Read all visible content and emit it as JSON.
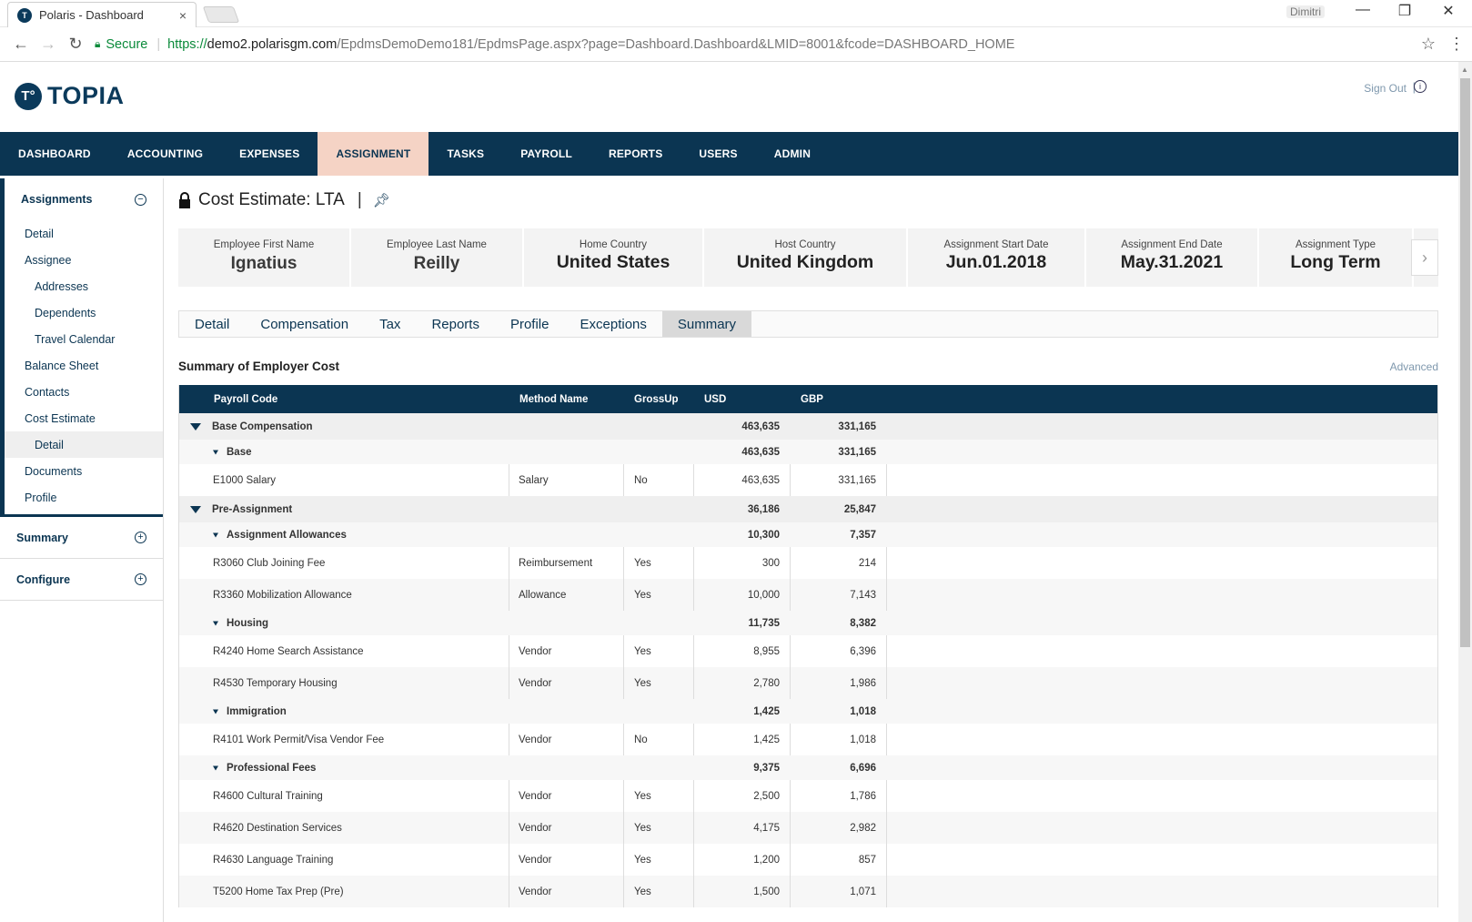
{
  "browser": {
    "tab_title": "Polaris - Dashboard",
    "tab_close": "×",
    "window_user": "Dimitri",
    "secure_label": "Secure",
    "url_proto": "https://",
    "url_host": "demo2.polarisgm.com",
    "url_path": "/EpdmsDemoDemo181/EpdmsPage.aspx?page=Dashboard.Dashboard&LMID=8001&fcode=DASHBOARD_HOME"
  },
  "app": {
    "logo_text": "TOPIA",
    "sign_out": "Sign Out"
  },
  "main_nav": [
    "DASHBOARD",
    "ACCOUNTING",
    "EXPENSES",
    "ASSIGNMENT",
    "TASKS",
    "PAYROLL",
    "REPORTS",
    "USERS",
    "ADMIN"
  ],
  "main_nav_active": "ASSIGNMENT",
  "sidebar": {
    "assignments_label": "Assignments",
    "items": [
      "Detail",
      "Assignee",
      "Addresses",
      "Dependents",
      "Travel Calendar",
      "Balance Sheet",
      "Contacts",
      "Cost Estimate",
      "Detail",
      "Documents",
      "Profile"
    ],
    "summary_label": "Summary",
    "configure_label": "Configure"
  },
  "page": {
    "title": "Cost Estimate: LTA"
  },
  "cards": [
    {
      "label": "Employee First Name",
      "value": "Ignatius"
    },
    {
      "label": "Employee Last Name",
      "value": "Reilly"
    },
    {
      "label": "Home Country",
      "value": "United States"
    },
    {
      "label": "Host Country",
      "value": "United Kingdom"
    },
    {
      "label": "Assignment Start Date",
      "value": "Jun.01.2018"
    },
    {
      "label": "Assignment End Date",
      "value": "May.31.2021"
    },
    {
      "label": "Assignment Type",
      "value": "Long Term"
    }
  ],
  "subtabs": [
    "Detail",
    "Compensation",
    "Tax",
    "Reports",
    "Profile",
    "Exceptions",
    "Summary"
  ],
  "subtab_active": "Summary",
  "summary": {
    "heading": "Summary of Employer Cost",
    "advanced": "Advanced",
    "columns": [
      "Payroll Code",
      "Method Name",
      "GrossUp",
      "USD",
      "GBP"
    ],
    "rows": [
      {
        "level": 1,
        "name": "Base Compensation",
        "usd": "463,635",
        "gbp": "331,165"
      },
      {
        "level": 2,
        "name": "Base",
        "usd": "463,635",
        "gbp": "331,165"
      },
      {
        "level": 3,
        "name": "E1000 Salary",
        "method": "Salary",
        "grossup": "No",
        "usd": "463,635",
        "gbp": "331,165"
      },
      {
        "level": 1,
        "name": "Pre-Assignment",
        "usd": "36,186",
        "gbp": "25,847"
      },
      {
        "level": 2,
        "name": "Assignment Allowances",
        "usd": "10,300",
        "gbp": "7,357"
      },
      {
        "level": 3,
        "name": "R3060 Club Joining Fee",
        "method": "Reimbursement",
        "grossup": "Yes",
        "usd": "300",
        "gbp": "214"
      },
      {
        "level": 3,
        "name": "R3360 Mobilization Allowance",
        "method": "Allowance",
        "grossup": "Yes",
        "usd": "10,000",
        "gbp": "7,143"
      },
      {
        "level": 2,
        "name": "Housing",
        "usd": "11,735",
        "gbp": "8,382"
      },
      {
        "level": 3,
        "name": "R4240 Home Search Assistance",
        "method": "Vendor",
        "grossup": "Yes",
        "usd": "8,955",
        "gbp": "6,396"
      },
      {
        "level": 3,
        "name": "R4530 Temporary Housing",
        "method": "Vendor",
        "grossup": "Yes",
        "usd": "2,780",
        "gbp": "1,986"
      },
      {
        "level": 2,
        "name": "Immigration",
        "usd": "1,425",
        "gbp": "1,018"
      },
      {
        "level": 3,
        "name": "R4101 Work Permit/Visa Vendor Fee",
        "method": "Vendor",
        "grossup": "No",
        "usd": "1,425",
        "gbp": "1,018"
      },
      {
        "level": 2,
        "name": "Professional Fees",
        "usd": "9,375",
        "gbp": "6,696"
      },
      {
        "level": 3,
        "name": "R4600 Cultural Training",
        "method": "Vendor",
        "grossup": "Yes",
        "usd": "2,500",
        "gbp": "1,786"
      },
      {
        "level": 3,
        "name": "R4620 Destination Services",
        "method": "Vendor",
        "grossup": "Yes",
        "usd": "4,175",
        "gbp": "2,982"
      },
      {
        "level": 3,
        "name": "R4630 Language Training",
        "method": "Vendor",
        "grossup": "Yes",
        "usd": "1,200",
        "gbp": "857"
      },
      {
        "level": 3,
        "name": "T5200 Home Tax Prep (Pre)",
        "method": "Vendor",
        "grossup": "Yes",
        "usd": "1,500",
        "gbp": "1,071"
      }
    ]
  },
  "colors": {
    "brand": "#0b3552",
    "active_nav": "#f5d3c5"
  }
}
